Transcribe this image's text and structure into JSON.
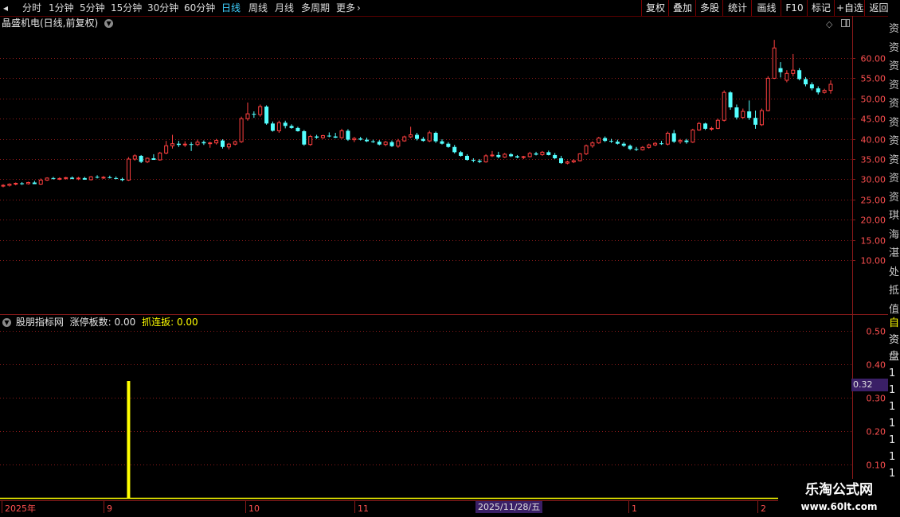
{
  "toolbar": {
    "periods": [
      "分时",
      "1分钟",
      "5分钟",
      "15分钟",
      "30分钟",
      "60分钟",
      "日线",
      "周线",
      "月线",
      "多周期",
      "更多"
    ],
    "active_period": "日线",
    "more_arrow": "›",
    "actions": [
      "复权",
      "叠加",
      "多股",
      "统计",
      "画线",
      "F10",
      "标记",
      "+自选",
      "返回"
    ]
  },
  "stock": {
    "title": "晶盛机电(日线,前复权)"
  },
  "price_axis": {
    "labels": [
      "60.00",
      "55.00",
      "50.00",
      "45.00",
      "40.00",
      "35.00",
      "30.00",
      "25.00",
      "20.00",
      "15.00",
      "10.00"
    ]
  },
  "indicator": {
    "name": "股朋指标网",
    "metric1_label": "涨停板数:",
    "metric1_value": "0.00",
    "metric2_label": "抓连扳:",
    "metric2_value": "0.00",
    "axis_labels": [
      "0.50",
      "0.40",
      "0.30",
      "0.20",
      "0.10"
    ],
    "current_value": "0.32"
  },
  "date_axis": {
    "labels": [
      "2025年",
      "9",
      "10",
      "11",
      "1",
      "2"
    ],
    "highlight": "2025/11/28/五"
  },
  "right_strip": {
    "chars": [
      "资",
      "资",
      "资",
      "资",
      "资",
      "资",
      "资",
      "资",
      "资",
      "资",
      "琪",
      "海",
      "湛",
      "处",
      "抵",
      "值"
    ],
    "lower_chars": [
      "自",
      "资",
      "盘",
      "1",
      "1",
      "1",
      "1",
      "1",
      "1",
      "1",
      "1"
    ]
  },
  "watermark": {
    "line1": "乐淘公式网",
    "line2": "www.60lt.com"
  },
  "colors": {
    "up": "#ff4040",
    "down": "#54ffff",
    "grid": "#8b1a1a",
    "bar": "#ffff00",
    "active": "#3fd0ff"
  },
  "chart_data": {
    "type": "candlestick",
    "ylim": [
      5,
      65
    ],
    "candles": [
      {
        "o": 28.3,
        "h": 28.8,
        "l": 28.0,
        "c": 28.5
      },
      {
        "o": 28.5,
        "h": 29.0,
        "l": 28.2,
        "c": 28.8
      },
      {
        "o": 28.8,
        "h": 29.2,
        "l": 28.5,
        "c": 29.0
      },
      {
        "o": 29.0,
        "h": 29.3,
        "l": 28.6,
        "c": 28.9
      },
      {
        "o": 28.9,
        "h": 29.4,
        "l": 28.7,
        "c": 29.2
      },
      {
        "o": 29.2,
        "h": 29.6,
        "l": 28.9,
        "c": 28.8
      },
      {
        "o": 28.8,
        "h": 30.2,
        "l": 28.6,
        "c": 29.8
      },
      {
        "o": 29.8,
        "h": 30.5,
        "l": 29.6,
        "c": 30.3
      },
      {
        "o": 30.3,
        "h": 30.6,
        "l": 29.9,
        "c": 30.1
      },
      {
        "o": 30.1,
        "h": 30.5,
        "l": 29.8,
        "c": 30.2
      },
      {
        "o": 30.2,
        "h": 30.6,
        "l": 29.9,
        "c": 30.4
      },
      {
        "o": 30.4,
        "h": 30.7,
        "l": 30.0,
        "c": 30.1
      },
      {
        "o": 30.1,
        "h": 30.6,
        "l": 29.8,
        "c": 30.3
      },
      {
        "o": 30.3,
        "h": 30.6,
        "l": 29.9,
        "c": 29.9
      },
      {
        "o": 29.9,
        "h": 30.8,
        "l": 29.7,
        "c": 30.6
      },
      {
        "o": 30.6,
        "h": 31.0,
        "l": 30.2,
        "c": 30.4
      },
      {
        "o": 30.4,
        "h": 30.8,
        "l": 30.1,
        "c": 30.5
      },
      {
        "o": 30.5,
        "h": 30.9,
        "l": 30.2,
        "c": 30.3
      },
      {
        "o": 30.3,
        "h": 30.7,
        "l": 30.0,
        "c": 30.1
      },
      {
        "o": 30.1,
        "h": 30.4,
        "l": 29.5,
        "c": 29.8
      },
      {
        "o": 29.8,
        "h": 35.5,
        "l": 29.6,
        "c": 35.0
      },
      {
        "o": 35.0,
        "h": 36.2,
        "l": 34.6,
        "c": 35.8
      },
      {
        "o": 35.8,
        "h": 36.0,
        "l": 34.0,
        "c": 34.3
      },
      {
        "o": 34.3,
        "h": 35.4,
        "l": 34.0,
        "c": 35.2
      },
      {
        "o": 35.2,
        "h": 36.2,
        "l": 34.9,
        "c": 34.8
      },
      {
        "o": 34.8,
        "h": 36.8,
        "l": 34.6,
        "c": 36.5
      },
      {
        "o": 36.5,
        "h": 39.5,
        "l": 36.2,
        "c": 38.3
      },
      {
        "o": 38.3,
        "h": 41.0,
        "l": 37.6,
        "c": 38.8
      },
      {
        "o": 38.8,
        "h": 39.5,
        "l": 38.0,
        "c": 38.5
      },
      {
        "o": 38.5,
        "h": 39.4,
        "l": 38.0,
        "c": 38.7
      },
      {
        "o": 38.7,
        "h": 39.2,
        "l": 37.0,
        "c": 38.6
      },
      {
        "o": 38.6,
        "h": 39.8,
        "l": 38.2,
        "c": 39.2
      },
      {
        "o": 39.2,
        "h": 39.6,
        "l": 38.5,
        "c": 38.9
      },
      {
        "o": 38.9,
        "h": 39.3,
        "l": 37.8,
        "c": 39.0
      },
      {
        "o": 39.0,
        "h": 40.0,
        "l": 38.6,
        "c": 39.6
      },
      {
        "o": 39.6,
        "h": 39.9,
        "l": 37.6,
        "c": 38.0
      },
      {
        "o": 38.0,
        "h": 39.0,
        "l": 37.4,
        "c": 38.7
      },
      {
        "o": 38.7,
        "h": 39.6,
        "l": 38.4,
        "c": 39.3
      },
      {
        "o": 39.3,
        "h": 45.5,
        "l": 39.0,
        "c": 45.0
      },
      {
        "o": 45.0,
        "h": 49.0,
        "l": 44.5,
        "c": 46.2
      },
      {
        "o": 46.2,
        "h": 46.8,
        "l": 45.2,
        "c": 46.0
      },
      {
        "o": 46.0,
        "h": 48.5,
        "l": 45.5,
        "c": 48.0
      },
      {
        "o": 48.0,
        "h": 48.3,
        "l": 43.5,
        "c": 43.8
      },
      {
        "o": 43.8,
        "h": 44.3,
        "l": 41.8,
        "c": 42.0
      },
      {
        "o": 42.0,
        "h": 44.5,
        "l": 41.5,
        "c": 44.0
      },
      {
        "o": 44.0,
        "h": 44.5,
        "l": 42.6,
        "c": 43.2
      },
      {
        "o": 43.2,
        "h": 43.6,
        "l": 42.5,
        "c": 42.7
      },
      {
        "o": 42.7,
        "h": 43.0,
        "l": 41.8,
        "c": 41.9
      },
      {
        "o": 41.9,
        "h": 42.2,
        "l": 38.3,
        "c": 38.6
      },
      {
        "o": 38.6,
        "h": 41.0,
        "l": 38.3,
        "c": 40.6
      },
      {
        "o": 40.6,
        "h": 41.0,
        "l": 40.0,
        "c": 40.3
      },
      {
        "o": 40.3,
        "h": 41.0,
        "l": 40.0,
        "c": 40.8
      },
      {
        "o": 40.8,
        "h": 41.6,
        "l": 40.4,
        "c": 40.6
      },
      {
        "o": 40.6,
        "h": 41.5,
        "l": 40.2,
        "c": 40.3
      },
      {
        "o": 40.3,
        "h": 42.5,
        "l": 40.0,
        "c": 42.0
      },
      {
        "o": 42.0,
        "h": 42.4,
        "l": 39.5,
        "c": 39.8
      },
      {
        "o": 39.8,
        "h": 40.5,
        "l": 39.2,
        "c": 40.1
      },
      {
        "o": 40.1,
        "h": 40.5,
        "l": 39.6,
        "c": 39.8
      },
      {
        "o": 39.8,
        "h": 40.3,
        "l": 39.2,
        "c": 39.4
      },
      {
        "o": 39.4,
        "h": 39.8,
        "l": 39.0,
        "c": 39.3
      },
      {
        "o": 39.3,
        "h": 39.7,
        "l": 38.4,
        "c": 38.6
      },
      {
        "o": 38.6,
        "h": 39.5,
        "l": 38.2,
        "c": 39.2
      },
      {
        "o": 39.2,
        "h": 39.6,
        "l": 38.0,
        "c": 38.2
      },
      {
        "o": 38.2,
        "h": 40.0,
        "l": 37.8,
        "c": 39.5
      },
      {
        "o": 39.5,
        "h": 40.8,
        "l": 39.3,
        "c": 40.5
      },
      {
        "o": 40.5,
        "h": 43.0,
        "l": 40.2,
        "c": 41.0
      },
      {
        "o": 41.0,
        "h": 41.5,
        "l": 39.6,
        "c": 40.0
      },
      {
        "o": 40.0,
        "h": 40.5,
        "l": 39.3,
        "c": 39.5
      },
      {
        "o": 39.5,
        "h": 42.0,
        "l": 39.2,
        "c": 41.5
      },
      {
        "o": 41.5,
        "h": 41.8,
        "l": 39.0,
        "c": 39.4
      },
      {
        "o": 39.4,
        "h": 39.9,
        "l": 38.6,
        "c": 38.8
      },
      {
        "o": 38.8,
        "h": 39.2,
        "l": 37.8,
        "c": 38.0
      },
      {
        "o": 38.0,
        "h": 38.5,
        "l": 36.4,
        "c": 36.7
      },
      {
        "o": 36.7,
        "h": 37.0,
        "l": 35.6,
        "c": 35.8
      },
      {
        "o": 35.8,
        "h": 36.2,
        "l": 34.6,
        "c": 34.8
      },
      {
        "o": 34.8,
        "h": 35.2,
        "l": 34.2,
        "c": 34.6
      },
      {
        "o": 34.6,
        "h": 35.0,
        "l": 34.0,
        "c": 34.3
      },
      {
        "o": 34.3,
        "h": 36.2,
        "l": 34.1,
        "c": 35.8
      },
      {
        "o": 35.8,
        "h": 37.0,
        "l": 35.5,
        "c": 36.0
      },
      {
        "o": 36.0,
        "h": 36.8,
        "l": 35.2,
        "c": 35.5
      },
      {
        "o": 35.5,
        "h": 36.5,
        "l": 35.3,
        "c": 36.2
      },
      {
        "o": 36.2,
        "h": 36.5,
        "l": 35.5,
        "c": 35.7
      },
      {
        "o": 35.7,
        "h": 36.0,
        "l": 35.2,
        "c": 35.4
      },
      {
        "o": 35.4,
        "h": 35.8,
        "l": 35.0,
        "c": 35.6
      },
      {
        "o": 35.6,
        "h": 36.8,
        "l": 35.4,
        "c": 36.4
      },
      {
        "o": 36.4,
        "h": 36.8,
        "l": 35.9,
        "c": 36.1
      },
      {
        "o": 36.1,
        "h": 37.0,
        "l": 35.8,
        "c": 36.7
      },
      {
        "o": 36.7,
        "h": 37.1,
        "l": 35.9,
        "c": 36.0
      },
      {
        "o": 36.0,
        "h": 36.5,
        "l": 35.0,
        "c": 35.2
      },
      {
        "o": 35.2,
        "h": 35.8,
        "l": 33.8,
        "c": 34.0
      },
      {
        "o": 34.0,
        "h": 34.6,
        "l": 33.7,
        "c": 34.3
      },
      {
        "o": 34.3,
        "h": 35.0,
        "l": 34.0,
        "c": 34.6
      },
      {
        "o": 34.6,
        "h": 36.5,
        "l": 34.4,
        "c": 36.3
      },
      {
        "o": 36.3,
        "h": 38.6,
        "l": 36.0,
        "c": 38.3
      },
      {
        "o": 38.3,
        "h": 39.4,
        "l": 37.8,
        "c": 39.0
      },
      {
        "o": 39.0,
        "h": 40.5,
        "l": 38.8,
        "c": 40.2
      },
      {
        "o": 40.2,
        "h": 40.6,
        "l": 39.2,
        "c": 39.5
      },
      {
        "o": 39.5,
        "h": 40.0,
        "l": 39.0,
        "c": 39.3
      },
      {
        "o": 39.3,
        "h": 39.8,
        "l": 38.6,
        "c": 38.8
      },
      {
        "o": 38.8,
        "h": 39.2,
        "l": 38.0,
        "c": 38.3
      },
      {
        "o": 38.3,
        "h": 38.6,
        "l": 37.2,
        "c": 37.5
      },
      {
        "o": 37.5,
        "h": 38.0,
        "l": 37.0,
        "c": 37.3
      },
      {
        "o": 37.3,
        "h": 38.2,
        "l": 37.1,
        "c": 37.9
      },
      {
        "o": 37.9,
        "h": 38.8,
        "l": 37.6,
        "c": 38.5
      },
      {
        "o": 38.5,
        "h": 39.2,
        "l": 38.2,
        "c": 38.9
      },
      {
        "o": 38.9,
        "h": 39.5,
        "l": 38.5,
        "c": 38.7
      },
      {
        "o": 38.7,
        "h": 41.8,
        "l": 38.4,
        "c": 41.4
      },
      {
        "o": 41.4,
        "h": 42.2,
        "l": 39.0,
        "c": 39.3
      },
      {
        "o": 39.3,
        "h": 40.0,
        "l": 38.8,
        "c": 39.6
      },
      {
        "o": 39.6,
        "h": 40.0,
        "l": 38.8,
        "c": 39.2
      },
      {
        "o": 39.2,
        "h": 42.5,
        "l": 39.0,
        "c": 42.2
      },
      {
        "o": 42.2,
        "h": 44.2,
        "l": 42.0,
        "c": 43.8
      },
      {
        "o": 43.8,
        "h": 44.0,
        "l": 42.2,
        "c": 42.5
      },
      {
        "o": 42.5,
        "h": 43.0,
        "l": 42.0,
        "c": 42.6
      },
      {
        "o": 42.6,
        "h": 45.0,
        "l": 42.4,
        "c": 44.6
      },
      {
        "o": 44.6,
        "h": 52.0,
        "l": 44.3,
        "c": 51.5
      },
      {
        "o": 51.5,
        "h": 51.8,
        "l": 47.2,
        "c": 47.8
      },
      {
        "o": 47.8,
        "h": 48.5,
        "l": 44.8,
        "c": 45.3
      },
      {
        "o": 45.3,
        "h": 47.5,
        "l": 45.0,
        "c": 46.8
      },
      {
        "o": 46.8,
        "h": 49.5,
        "l": 44.7,
        "c": 45.2
      },
      {
        "o": 45.2,
        "h": 47.0,
        "l": 42.5,
        "c": 43.5
      },
      {
        "o": 43.5,
        "h": 47.5,
        "l": 43.2,
        "c": 47.0
      },
      {
        "o": 47.0,
        "h": 55.5,
        "l": 46.8,
        "c": 55.0
      },
      {
        "o": 55.0,
        "h": 64.5,
        "l": 54.8,
        "c": 62.5
      },
      {
        "o": 57.5,
        "h": 59.0,
        "l": 55.2,
        "c": 56.5
      },
      {
        "o": 54.5,
        "h": 57.0,
        "l": 54.0,
        "c": 56.2
      },
      {
        "o": 56.2,
        "h": 61.0,
        "l": 55.5,
        "c": 57.0
      },
      {
        "o": 57.0,
        "h": 57.5,
        "l": 54.5,
        "c": 54.8
      },
      {
        "o": 54.8,
        "h": 55.3,
        "l": 53.0,
        "c": 53.5
      },
      {
        "o": 53.5,
        "h": 54.0,
        "l": 52.0,
        "c": 52.5
      },
      {
        "o": 52.5,
        "h": 53.0,
        "l": 51.0,
        "c": 51.5
      },
      {
        "o": 51.5,
        "h": 52.4,
        "l": 51.2,
        "c": 52.0
      },
      {
        "o": 52.0,
        "h": 54.5,
        "l": 51.2,
        "c": 53.5
      }
    ],
    "indicator_bars": [
      {
        "index": 20,
        "value": 0.35
      }
    ],
    "indicator_ylim": [
      0,
      0.55
    ]
  }
}
